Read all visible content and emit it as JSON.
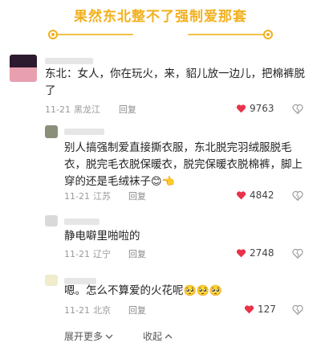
{
  "banner": {
    "title": "果然东北整不了强制爱那套"
  },
  "comments": [
    {
      "text": "东北：女人，你在玩火，来，貂儿放一边儿，把棉裤脱了",
      "date": "11-21",
      "location": "黑龙江",
      "reply_label": "回复",
      "likes": "9763"
    },
    {
      "text": "别人搞强制爱直接撕衣服，东北脱完羽绒服脱毛衣，脱完毛衣脱保暖衣，脱完保暖衣脱棉裤，脚上穿的还是毛绒袜子",
      "date": "11-21",
      "location": "江苏",
      "reply_label": "回复",
      "likes": "4842"
    },
    {
      "text": "静电噼里啪啦的",
      "date": "11-21",
      "location": "辽宁",
      "reply_label": "回复",
      "likes": "2748"
    },
    {
      "text": "嗯。怎么不算爱的火花呢",
      "date": "11-21",
      "location": "北京",
      "reply_label": "回复",
      "likes": "127"
    }
  ],
  "footer": {
    "expand_label": "展开更多",
    "collapse_label": "收起"
  },
  "colors": {
    "banner_title": "#f2b01e",
    "heart": "#e8334a"
  }
}
